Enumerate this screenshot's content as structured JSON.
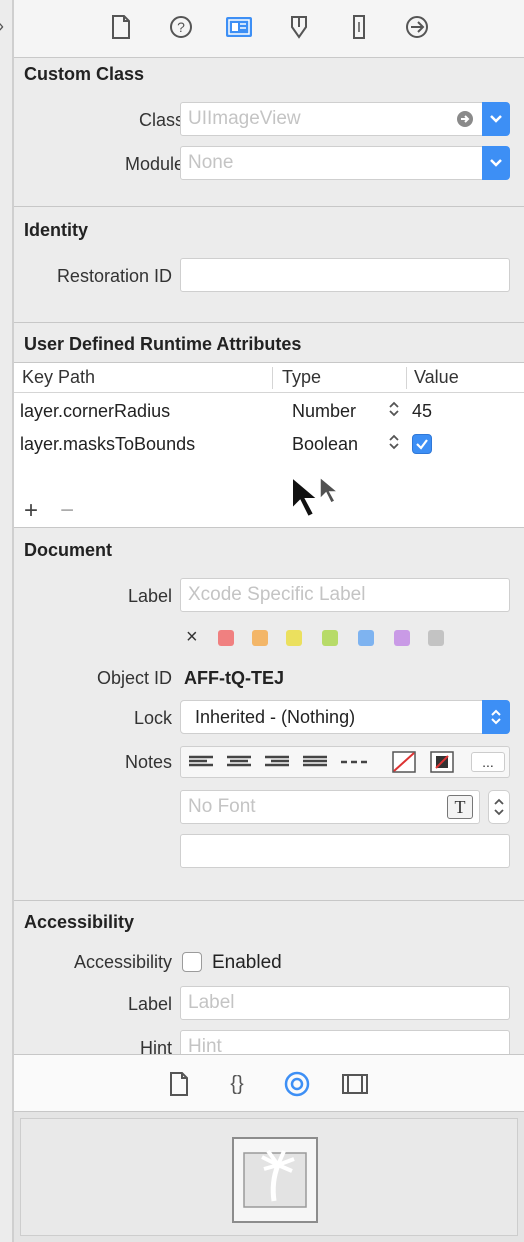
{
  "toolbar": {
    "icons": [
      "file-inspector-icon",
      "quick-help-icon",
      "identity-inspector-icon",
      "attributes-inspector-icon",
      "size-inspector-icon",
      "connections-inspector-icon"
    ]
  },
  "custom_class": {
    "header": "Custom Class",
    "class_label": "Class",
    "class_placeholder": "UIImageView",
    "module_label": "Module",
    "module_placeholder": "None"
  },
  "identity": {
    "header": "Identity",
    "restoration_label": "Restoration ID",
    "restoration_value": ""
  },
  "runtime_attributes": {
    "header": "User Defined Runtime Attributes",
    "columns": [
      "Key Path",
      "Type",
      "Value"
    ],
    "rows": [
      {
        "key_path": "layer.cornerRadius",
        "type": "Number",
        "value": "45"
      },
      {
        "key_path": "layer.masksToBounds",
        "type": "Boolean",
        "value": "checked"
      }
    ],
    "add": "+",
    "remove": "−"
  },
  "document": {
    "header": "Document",
    "label_label": "Label",
    "label_placeholder": "Xcode Specific Label",
    "color_clear": "×",
    "colors": [
      "#f08080",
      "#f3b668",
      "#ebe05e",
      "#b7db68",
      "#7eb3f0",
      "#c99ae6",
      "#c3c3c3"
    ],
    "object_id_label": "Object ID",
    "object_id_value": "AFF-tQ-TEJ",
    "lock_label": "Lock",
    "lock_value": "Inherited - (Nothing)",
    "notes_label": "Notes",
    "notes_more": "...",
    "font_placeholder": "No Font",
    "font_button": "T"
  },
  "accessibility": {
    "header": "Accessibility",
    "accessibility_label": "Accessibility",
    "enabled_label": "Enabled",
    "label_label": "Label",
    "label_placeholder": "Label",
    "hint_label": "Hint",
    "hint_placeholder": "Hint"
  },
  "bottom_bar": {
    "icons": [
      "file-template-icon",
      "code-snippet-icon",
      "object-library-icon",
      "media-library-icon"
    ]
  },
  "colors": {
    "accent": "#3d8ff5",
    "panel_bg": "#ececec"
  }
}
